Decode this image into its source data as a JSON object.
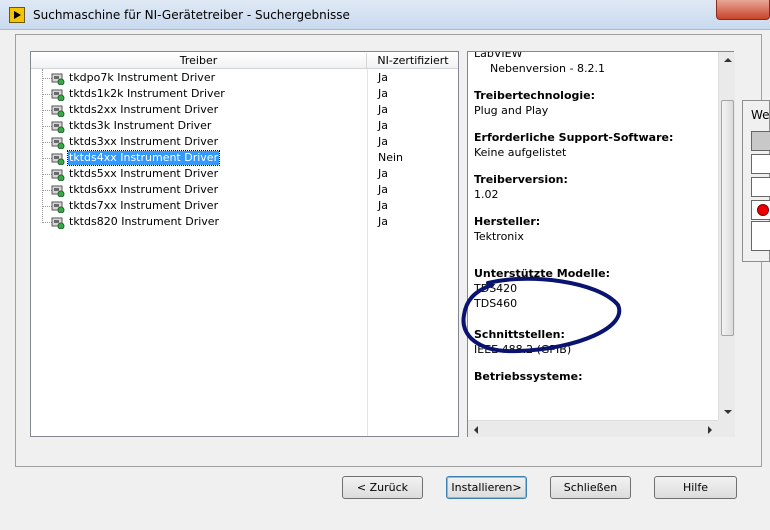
{
  "window": {
    "title": "Suchmaschine für NI-Gerätetreiber - Suchergebnisse"
  },
  "tree": {
    "col_driver": "Treiber",
    "col_certified": "NI-zertifiziert",
    "rows": [
      {
        "name": "tkdpo7k Instrument Driver",
        "certified": "Ja"
      },
      {
        "name": "tktds1k2k Instrument Driver",
        "certified": "Ja"
      },
      {
        "name": "tktds2xx Instrument Driver",
        "certified": "Ja"
      },
      {
        "name": "tktds3k Instrument Driver",
        "certified": "Ja"
      },
      {
        "name": "tktds3xx Instrument Driver",
        "certified": "Ja"
      },
      {
        "name": "tktds4xx Instrument Driver",
        "certified": "Nein"
      },
      {
        "name": "tktds5xx Instrument Driver",
        "certified": "Ja"
      },
      {
        "name": "tktds6xx Instrument Driver",
        "certified": "Ja"
      },
      {
        "name": "tktds7xx Instrument Driver",
        "certified": "Ja"
      },
      {
        "name": "tktds820 Instrument Driver",
        "certified": "Ja"
      }
    ]
  },
  "details": {
    "labview_label": "LabVIEW",
    "labview_version": "Nebenversion - 8.2.1",
    "tech_label": "Treibertechnologie:",
    "tech_value": "Plug and Play",
    "support_label": "Erforderliche Support-Software:",
    "support_value": "Keine aufgelistet",
    "version_label": "Treiberversion:",
    "version_value": "1.02",
    "maker_label": "Hersteller:",
    "maker_value": "Tektronix",
    "models_label": "Unterstützte Modelle:",
    "model_1": "TDS420",
    "model_2": "TDS460",
    "iface_label": "Schnittstellen:",
    "iface_value": "IEEE 488.2 (GPIB)",
    "os_label": "Betriebssysteme:"
  },
  "buttons": {
    "back": "< Zurück",
    "install": "Installieren>",
    "close": "Schließen",
    "help": "Hilfe"
  },
  "palette": {
    "header": "We"
  },
  "colors": {
    "selection": "#3399ff",
    "annotation": "#0a1470"
  }
}
